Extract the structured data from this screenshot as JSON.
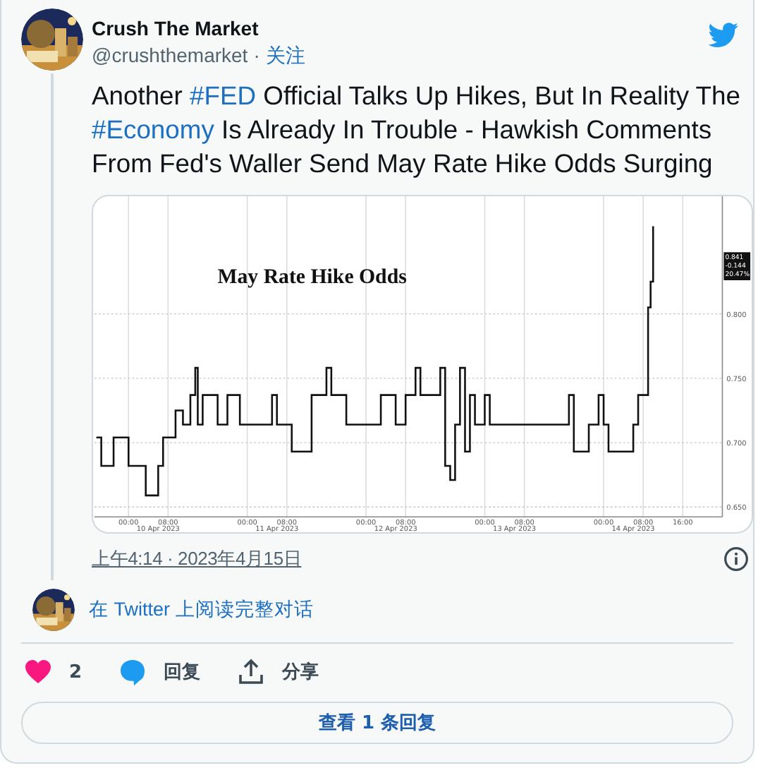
{
  "author": {
    "name": "Crush The Market",
    "handle": "@crushthemarket",
    "separator": "·",
    "follow": "关注"
  },
  "tweet": {
    "segments": [
      {
        "kind": "text",
        "text": "Another "
      },
      {
        "kind": "hashtag",
        "text": "#FED"
      },
      {
        "kind": "text",
        "text": " Official Talks Up Hikes, But In Reality The "
      },
      {
        "kind": "hashtag",
        "text": "#Economy"
      },
      {
        "kind": "text",
        "text": " Is Already In Trouble - Hawkish Comments From Fed's Waller Send May Rate Hike Odds Surging"
      }
    ],
    "media": {
      "chart_data": {
        "type": "line",
        "title": "May Rate Hike Odds",
        "grid": true,
        "xlim": [
          "2023-04-09T17:24",
          "2023-04-15T00:00"
        ],
        "ylim": [
          0.6424,
          0.8913
        ],
        "xticks": [
          {
            "value": "2023-04-10T00:00",
            "label": "00:00"
          },
          {
            "value": "2023-04-10T08:00",
            "label": "08:00"
          },
          {
            "value": "2023-04-11T00:00",
            "label": "00:00"
          },
          {
            "value": "2023-04-11T08:00",
            "label": "08:00"
          },
          {
            "value": "2023-04-12T00:00",
            "label": "00:00"
          },
          {
            "value": "2023-04-12T08:00",
            "label": "08:00"
          },
          {
            "value": "2023-04-13T00:00",
            "label": "00:00"
          },
          {
            "value": "2023-04-13T08:00",
            "label": "08:00"
          },
          {
            "value": "2023-04-14T00:00",
            "label": "00:00"
          },
          {
            "value": "2023-04-14T08:00",
            "label": "08:00"
          },
          {
            "value": "2023-04-14T16:00",
            "label": "16:00"
          }
        ],
        "yticks": [
          {
            "value": 0.65,
            "label": "0.650"
          },
          {
            "value": 0.7,
            "label": "0.700"
          },
          {
            "value": 0.75,
            "label": "0.750"
          },
          {
            "value": 0.8,
            "label": "0.800"
          }
        ],
        "x": [
          "2023-04-09T17:30",
          "2023-04-09T18:30",
          "2023-04-09T18:30",
          "2023-04-09T21:00",
          "2023-04-09T21:00",
          "2023-04-10T00:00",
          "2023-04-10T00:00",
          "2023-04-10T03:30",
          "2023-04-10T03:30",
          "2023-04-10T06:00",
          "2023-04-10T06:00",
          "2023-04-10T07:00",
          "2023-04-10T07:00",
          "2023-04-10T09:30",
          "2023-04-10T09:30",
          "2023-04-10T11:00",
          "2023-04-10T11:00",
          "2023-04-10T12:30",
          "2023-04-10T12:30",
          "2023-04-10T13:30",
          "2023-04-10T13:30",
          "2023-04-10T14:00",
          "2023-04-10T14:00",
          "2023-04-10T15:00",
          "2023-04-10T15:00",
          "2023-04-10T18:00",
          "2023-04-10T18:00",
          "2023-04-10T20:00",
          "2023-04-10T20:00",
          "2023-04-10T22:30",
          "2023-04-10T22:30",
          "2023-04-11T05:00",
          "2023-04-11T05:00",
          "2023-04-11T06:00",
          "2023-04-11T06:00",
          "2023-04-11T09:00",
          "2023-04-11T09:00",
          "2023-04-11T13:00",
          "2023-04-11T13:00",
          "2023-04-11T16:00",
          "2023-04-11T16:00",
          "2023-04-11T17:00",
          "2023-04-11T17:00",
          "2023-04-11T20:00",
          "2023-04-11T20:00",
          "2023-04-12T03:00",
          "2023-04-12T03:00",
          "2023-04-12T06:00",
          "2023-04-12T06:00",
          "2023-04-12T08:00",
          "2023-04-12T08:00",
          "2023-04-12T10:00",
          "2023-04-12T10:00",
          "2023-04-12T11:00",
          "2023-04-12T11:00",
          "2023-04-12T15:00",
          "2023-04-12T15:00",
          "2023-04-12T16:00",
          "2023-04-12T16:00",
          "2023-04-12T17:00",
          "2023-04-12T17:00",
          "2023-04-12T18:00",
          "2023-04-12T18:00",
          "2023-04-12T19:00",
          "2023-04-12T19:00",
          "2023-04-12T20:00",
          "2023-04-12T20:00",
          "2023-04-12T21:00",
          "2023-04-12T21:00",
          "2023-04-12T22:00",
          "2023-04-12T22:00",
          "2023-04-13T00:00",
          "2023-04-13T00:00",
          "2023-04-13T01:00",
          "2023-04-13T01:00",
          "2023-04-13T17:00",
          "2023-04-13T17:00",
          "2023-04-13T18:00",
          "2023-04-13T18:00",
          "2023-04-13T21:00",
          "2023-04-13T21:00",
          "2023-04-13T23:00",
          "2023-04-13T23:00",
          "2023-04-14T00:00",
          "2023-04-14T00:00",
          "2023-04-14T01:00",
          "2023-04-14T01:00",
          "2023-04-14T06:00",
          "2023-04-14T06:00",
          "2023-04-14T07:00",
          "2023-04-14T07:00",
          "2023-04-14T09:00",
          "2023-04-14T09:00",
          "2023-04-14T09:30",
          "2023-04-14T09:30",
          "2023-04-14T10:00",
          "2023-04-14T10:00"
        ],
        "series": [
          {
            "color": "#111111",
            "values": [
              0.704,
              0.704,
              0.682,
              0.682,
              0.704,
              0.704,
              0.682,
              0.682,
              0.659,
              0.659,
              0.682,
              0.682,
              0.704,
              0.704,
              0.725,
              0.725,
              0.714,
              0.714,
              0.737,
              0.737,
              0.758,
              0.758,
              0.714,
              0.714,
              0.737,
              0.737,
              0.714,
              0.714,
              0.737,
              0.737,
              0.714,
              0.714,
              0.737,
              0.737,
              0.714,
              0.714,
              0.693,
              0.693,
              0.737,
              0.737,
              0.758,
              0.758,
              0.737,
              0.737,
              0.714,
              0.714,
              0.737,
              0.737,
              0.714,
              0.714,
              0.737,
              0.737,
              0.758,
              0.758,
              0.737,
              0.737,
              0.758,
              0.758,
              0.682,
              0.682,
              0.671,
              0.671,
              0.714,
              0.714,
              0.758,
              0.758,
              0.693,
              0.693,
              0.737,
              0.737,
              0.714,
              0.714,
              0.737,
              0.737,
              0.714,
              0.714,
              0.737,
              0.737,
              0.693,
              0.693,
              0.714,
              0.714,
              0.737,
              0.737,
              0.714,
              0.714,
              0.693,
              0.693,
              0.714,
              0.714,
              0.737,
              0.737,
              0.805,
              0.805,
              0.825,
              0.825,
              0.868
            ]
          }
        ],
        "annotations": [
          "10 Apr 2023",
          "11 Apr 2023",
          "12 Apr 2023",
          "13 Apr 2023",
          "14 Apr 2023"
        ]
      },
      "value_badge": [
        "0.841",
        "-0.144",
        "20.47%"
      ]
    },
    "time": "上午4:14 · 2023年4月15日"
  },
  "conversation_link": "在 Twitter 上阅读完整对话",
  "actions": [
    {
      "kind": "like",
      "label": "2"
    },
    {
      "kind": "reply",
      "label": "回复"
    },
    {
      "kind": "share",
      "label": "分享"
    }
  ],
  "replies_button": "查看 1 条回复"
}
